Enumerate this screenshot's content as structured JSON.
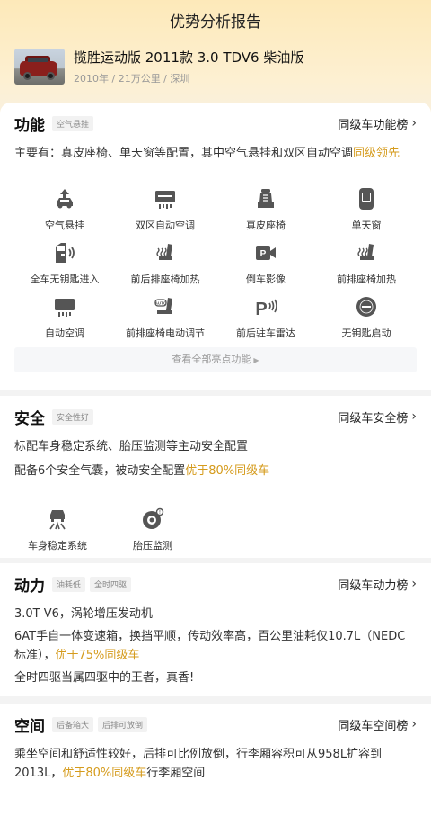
{
  "page_title": "优势分析报告",
  "car": {
    "name": "揽胜运动版 2011款 3.0 TDV6 柴油版",
    "meta": "2010年 / 21万公里 / 深圳"
  },
  "function": {
    "title": "功能",
    "tag": "空气悬挂",
    "rank": "同级车功能榜",
    "desc_prefix": "主要有：真皮座椅、单天窗等配置，其中空气悬挂和双区自动空调",
    "desc_highlight": "同级领先",
    "features": [
      {
        "label": "空气悬挂",
        "icon": "air-suspension-icon"
      },
      {
        "label": "双区自动空调",
        "icon": "dual-zone-ac-icon"
      },
      {
        "label": "真皮座椅",
        "icon": "leather-seat-icon"
      },
      {
        "label": "单天窗",
        "icon": "sunroof-icon"
      },
      {
        "label": "全车无钥匙进入",
        "icon": "keyless-entry-icon"
      },
      {
        "label": "前后排座椅加热",
        "icon": "seat-heating-icon"
      },
      {
        "label": "倒车影像",
        "icon": "reverse-camera-icon"
      },
      {
        "label": "前排座椅加热",
        "icon": "front-seat-heating-icon"
      },
      {
        "label": "自动空调",
        "icon": "auto-ac-icon"
      },
      {
        "label": "前排座椅电动调节",
        "icon": "power-seat-icon"
      },
      {
        "label": "前后驻车雷达",
        "icon": "parking-radar-icon"
      },
      {
        "label": "无钥匙启动",
        "icon": "keyless-start-icon"
      }
    ],
    "view_all": "查看全部亮点功能"
  },
  "safety": {
    "title": "安全",
    "tag": "安全性好",
    "rank": "同级车安全榜",
    "line1": "标配车身稳定系统、胎压监测等主动安全配置",
    "line2_prefix": "配备6个安全气囊，被动安全配置",
    "line2_highlight": "优于80%同级车",
    "features": [
      {
        "label": "车身稳定系统",
        "icon": "esp-icon"
      },
      {
        "label": "胎压监测",
        "icon": "tire-pressure-icon"
      }
    ]
  },
  "power": {
    "title": "动力",
    "tags": [
      "油耗低",
      "全时四驱"
    ],
    "rank": "同级车动力榜",
    "line1": "3.0T V6，涡轮增压发动机",
    "line2_prefix": "6AT手自一体变速箱，换挡平顺，传动效率高，百公里油耗仅10.7L（NEDC标准），",
    "line2_highlight": "优于75%同级车",
    "line3": "全时四驱当属四驱中的王者，真香!"
  },
  "space": {
    "title": "空间",
    "tags": [
      "后备箱大",
      "后排可放倒"
    ],
    "rank": "同级车空间榜",
    "line1_prefix": "乘坐空间和舒适性较好，后排可比例放倒，行李厢容积可从958L扩容到2013L，",
    "line1_highlight": "优于80%同级车",
    "line1_suffix": "行李厢空间"
  },
  "colors": {
    "highlight": "#d59b1c",
    "header_gradient_top": "#fde9b9"
  }
}
